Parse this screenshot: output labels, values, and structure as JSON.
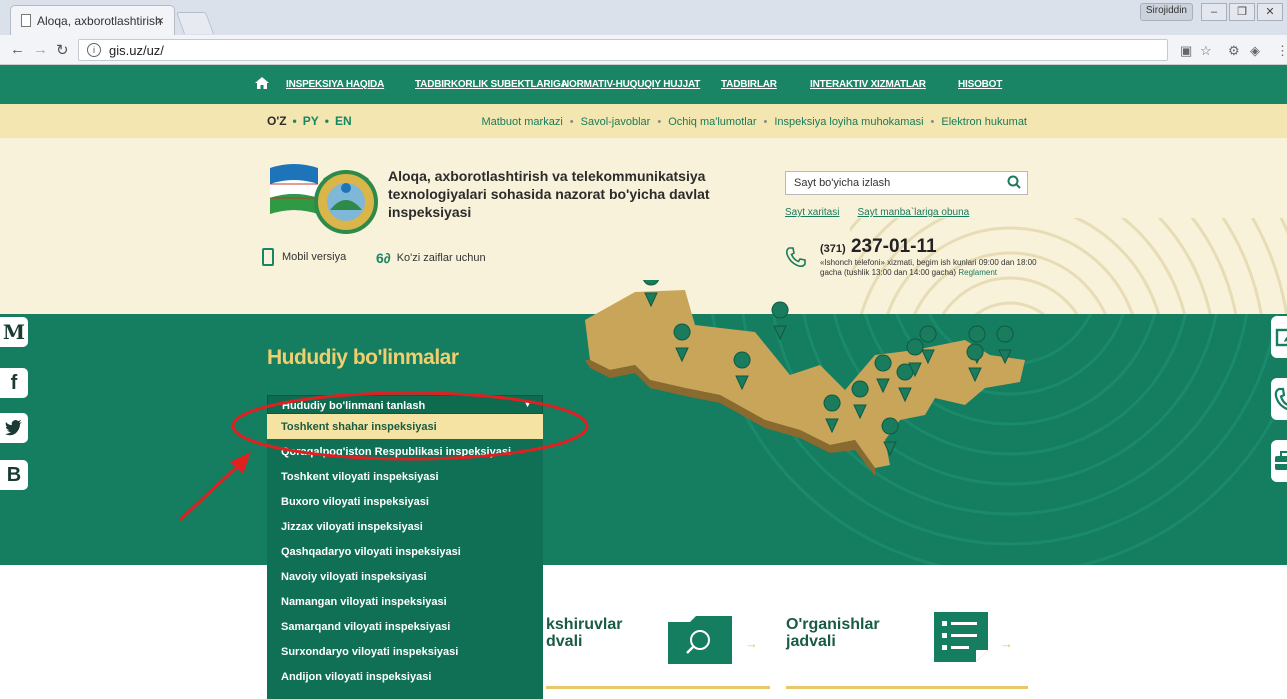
{
  "browser": {
    "tab_title": "Aloqa, axborotlashtirish",
    "tab_close": "×",
    "profile_name": "Sirojiddin",
    "url": "gis.uz/uz/"
  },
  "topnav": {
    "items": [
      "INSPEKSIYA HAQIDA",
      "TADBIRKORLIK SUBEKTLARIGA",
      "NORMATIV-HUQUQIY HUJJAT",
      "TADBIRLAR",
      "INTERAKTIV XIZMATLAR",
      "HISOBOT"
    ]
  },
  "subbar": {
    "lang_uz": "O'Z",
    "lang_ru": "PY",
    "lang_en": "EN",
    "links": [
      "Matbuot markazi",
      "Savol-javoblar",
      "Ochiq ma'lumotlar",
      "Inspeksiya loyiha muhokamasi",
      "Elektron hukumat"
    ]
  },
  "header": {
    "org_name": "Aloqa, axborotlashtirish va telekommunikatsiya texnologiyalari sohasida nazorat bo'yicha davlat inspeksiyasi",
    "mobile_label": "Mobil versiya",
    "low_vision_label": "Ko'zi zaiflar uchun",
    "search_placeholder": "Sayt bo'yicha izlash",
    "sitemap_link": "Sayt xaritasi",
    "subscribe_link": "Sayt manba`lariga obuna",
    "phone_code": "(371)",
    "phone_number": "237-01-11",
    "phone_note": "«Ishonch telefoni» xizmati, begim ish kunlari 09:00 dan 18:00 gacha (tushlik 13:00 dan 14:00 gacha)",
    "reglament": "Reglament"
  },
  "regional": {
    "title": "Hududiy bo'linmalar",
    "select_label": "Hududiy bo'linmani tanlash",
    "options": [
      "Toshkent shahar inspeksiyasi",
      "Qoraqalpog'iston Respublikasi inspeksiyasi",
      "Toshkent viloyati inspeksiyasi",
      "Buxoro viloyati inspeksiyasi",
      "Jizzax viloyati inspeksiyasi",
      "Qashqadaryo viloyati inspeksiyasi",
      "Navoiy viloyati inspeksiyasi",
      "Namangan viloyati inspeksiyasi",
      "Samarqand viloyati inspeksiyasi",
      "Surxondaryo viloyati inspeksiyasi",
      "Andijon viloyati inspeksiyasi"
    ],
    "selected_index": 0
  },
  "social": {
    "m": "M",
    "f": "f",
    "b": "B"
  },
  "cards": {
    "inspections_line1": "kshiruvlar",
    "inspections_line2": "dvali",
    "studies_line1": "O'rganishlar",
    "studies_line2": "jadvali",
    "arrow": "→"
  },
  "colors": {
    "brand_green": "#157d60",
    "accent_gold": "#f2cf6e",
    "annotation_red": "#e02020"
  }
}
